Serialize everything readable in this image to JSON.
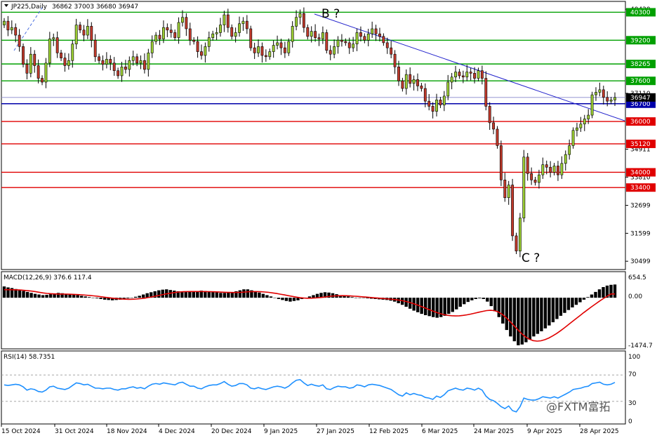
{
  "header": {
    "symbol": "JP225,Daily",
    "ohlc": "36862 37003 36680 36947"
  },
  "chart_data": [
    {
      "type": "candlestick",
      "title": "JP225,Daily",
      "ylim": [
        30200,
        40700
      ],
      "yticks": [
        40420,
        40300,
        39200,
        38265,
        37600,
        37110,
        36947,
        36700,
        36000,
        35120,
        34911,
        34000,
        33810,
        33400,
        32699,
        31599,
        30499
      ],
      "xlabels": [
        "15 Oct 2024",
        "31 Oct 2024",
        "18 Nov 2024",
        "4 Dec 2024",
        "20 Dec 2024",
        "9 Jan 2025",
        "27 Jan 2025",
        "12 Feb 2025",
        "6 Mar 2025",
        "24 Mar 2025",
        "9 Apr 2025",
        "28 Apr 2025"
      ],
      "levels": [
        {
          "value": 40300,
          "label": "40300",
          "color": "#00a000"
        },
        {
          "value": 39200,
          "label": "39200",
          "color": "#00a000"
        },
        {
          "value": 38265,
          "label": "38265",
          "color": "#00a000"
        },
        {
          "value": 37600,
          "label": "37600",
          "color": "#00a000"
        },
        {
          "value": 36700,
          "label": "36700",
          "color": "#0000aa"
        },
        {
          "value": 36000,
          "label": "36000",
          "color": "#e00000"
        },
        {
          "value": 35120,
          "label": "35120",
          "color": "#e00000"
        },
        {
          "value": 34000,
          "label": "34000",
          "color": "#e00000"
        },
        {
          "value": 33400,
          "label": "33400",
          "color": "#e00000"
        }
      ],
      "current_price": {
        "value": 36947,
        "label": "36947"
      },
      "annotations": [
        "B ?",
        "C ?"
      ],
      "bull_color": "#9acd32",
      "bear_color": "#c0392b",
      "closes": [
        39950,
        39600,
        39700,
        39400,
        38950,
        38250,
        37900,
        38650,
        38200,
        37700,
        37550,
        38300,
        39250,
        39300,
        38700,
        38500,
        38200,
        38400,
        39050,
        39800,
        39600,
        39400,
        39750,
        39200,
        38550,
        38400,
        38250,
        38450,
        38300,
        38000,
        37800,
        38150,
        38050,
        38400,
        38550,
        38300,
        38400,
        38050,
        38700,
        39150,
        39400,
        39250,
        39700,
        39600,
        39500,
        39300,
        39900,
        40100,
        39650,
        39200,
        39150,
        38750,
        38600,
        38950,
        39300,
        39450,
        39500,
        39800,
        40200,
        39700,
        39350,
        39500,
        39850,
        39950,
        39650,
        38900,
        38700,
        38950,
        38600,
        38550,
        38750,
        39000,
        39100,
        38900,
        38700,
        39150,
        39750,
        40100,
        40250,
        39700,
        39350,
        39550,
        39300,
        39250,
        39500,
        38800,
        38650,
        38950,
        39200,
        39150,
        39100,
        38900,
        39050,
        39500,
        39350,
        39200,
        39450,
        39650,
        39450,
        39350,
        39100,
        38900,
        38650,
        38150,
        37600,
        37300,
        37850,
        37500,
        37650,
        37400,
        37300,
        36800,
        36600,
        36400,
        36850,
        36650,
        37000,
        37550,
        37750,
        37950,
        37800,
        37750,
        37950,
        37900,
        37700,
        38000,
        37700,
        36600,
        35950,
        35700,
        35050,
        33700,
        33000,
        33500,
        31500,
        30900,
        32200,
        34600,
        33950,
        33700,
        33600,
        33900,
        34300,
        34200,
        34000,
        34250,
        33900,
        34350,
        34700,
        35050,
        35650,
        35750,
        35900,
        36100,
        36250,
        37050,
        37150,
        37250,
        36950,
        36800,
        36850,
        36947
      ],
      "macd": {
        "label": "MACD(12,26,9) 376.6 117.4",
        "yticks": [
          "654.5",
          "0.00",
          "-1474.7"
        ],
        "ylim": [
          -1520,
          700
        ],
        "histogram": [
          350,
          320,
          300,
          270,
          240,
          210,
          180,
          150,
          120,
          100,
          80,
          90,
          110,
          130,
          150,
          140,
          120,
          100,
          90,
          80,
          60,
          40,
          20,
          0,
          -20,
          -40,
          -60,
          -70,
          -80,
          -70,
          -60,
          -40,
          -20,
          0,
          30,
          60,
          100,
          140,
          170,
          200,
          230,
          250,
          260,
          240,
          220,
          200,
          190,
          180,
          190,
          200,
          210,
          220,
          210,
          200,
          190,
          170,
          150,
          150,
          160,
          170,
          200,
          230,
          260,
          260,
          230,
          200,
          160,
          120,
          80,
          40,
          0,
          -40,
          -70,
          -100,
          -120,
          -100,
          -80,
          -40,
          0,
          40,
          80,
          120,
          150,
          170,
          160,
          140,
          110,
          80,
          60,
          40,
          20,
          0,
          -10,
          -10,
          -20,
          -30,
          -40,
          -50,
          -60,
          -70,
          -90,
          -120,
          -170,
          -220,
          -280,
          -340,
          -400,
          -450,
          -500,
          -540,
          -570,
          -600,
          -620,
          -600,
          -560,
          -500,
          -440,
          -360,
          -280,
          -200,
          -130,
          -80,
          -40,
          -20,
          -40,
          -120,
          -260,
          -420,
          -600,
          -800,
          -1000,
          -1200,
          -1350,
          -1474,
          -1450,
          -1380,
          -1300,
          -1200,
          -1120,
          -1040,
          -950,
          -860,
          -760,
          -660,
          -560,
          -470,
          -380,
          -300,
          -220,
          -140,
          -60,
          20,
          100,
          180,
          260,
          330,
          376,
          400,
          410
        ],
        "signal": [
          250,
          250,
          248,
          245,
          240,
          230,
          220,
          205,
          190,
          170,
          150,
          135,
          125,
          118,
          115,
          115,
          112,
          108,
          104,
          98,
          90,
          80,
          70,
          58,
          45,
          30,
          15,
          0,
          -15,
          -28,
          -38,
          -45,
          -48,
          -46,
          -40,
          -30,
          -15,
          5,
          28,
          52,
          78,
          104,
          128,
          148,
          165,
          178,
          186,
          190,
          192,
          192,
          192,
          192,
          190,
          188,
          185,
          180,
          174,
          168,
          164,
          162,
          164,
          170,
          178,
          186,
          190,
          190,
          186,
          178,
          166,
          150,
          132,
          110,
          88,
          64,
          42,
          20,
          2,
          -10,
          -16,
          -14,
          -8,
          2,
          16,
          32,
          46,
          56,
          62,
          64,
          62,
          56,
          48,
          40,
          30,
          20,
          10,
          0,
          -10,
          -20,
          -30,
          -40,
          -52,
          -66,
          -84,
          -108,
          -138,
          -174,
          -214,
          -260,
          -308,
          -356,
          -404,
          -448,
          -488,
          -520,
          -544,
          -558,
          -564,
          -560,
          -548,
          -530,
          -506,
          -478,
          -450,
          -422,
          -400,
          -390,
          -400,
          -440,
          -510,
          -610,
          -730,
          -860,
          -990,
          -1110,
          -1210,
          -1285,
          -1330,
          -1345,
          -1335,
          -1300,
          -1250,
          -1185,
          -1110,
          -1025,
          -935,
          -840,
          -745,
          -650,
          -555,
          -460,
          -370,
          -280,
          -195,
          -110,
          -30,
          50,
          117,
          117
        ]
      },
      "rsi": {
        "label": "RSI(14) 58.7351",
        "yticks": [
          "100",
          "70",
          "30",
          "0"
        ],
        "ylim": [
          0,
          100
        ],
        "levels": [
          70,
          30
        ],
        "values": [
          55,
          54,
          55,
          56,
          55,
          52,
          47,
          49,
          48,
          45,
          44,
          47,
          52,
          53,
          50,
          49,
          48,
          50,
          54,
          58,
          57,
          55,
          56,
          53,
          50,
          50,
          49,
          50,
          50,
          48,
          47,
          49,
          49,
          51,
          52,
          50,
          51,
          49,
          53,
          56,
          57,
          56,
          58,
          57,
          56,
          55,
          58,
          59,
          56,
          53,
          53,
          50,
          49,
          52,
          54,
          55,
          55,
          57,
          60,
          56,
          53,
          54,
          57,
          57,
          55,
          50,
          49,
          51,
          49,
          48,
          50,
          52,
          53,
          52,
          50,
          53,
          58,
          62,
          63,
          58,
          54,
          56,
          54,
          53,
          55,
          49,
          48,
          51,
          53,
          52,
          52,
          50,
          51,
          55,
          54,
          52,
          55,
          56,
          55,
          54,
          52,
          50,
          48,
          44,
          40,
          38,
          43,
          40,
          42,
          40,
          39,
          36,
          35,
          33,
          38,
          36,
          40,
          46,
          48,
          50,
          48,
          47,
          50,
          49,
          47,
          50,
          47,
          38,
          33,
          31,
          27,
          22,
          19,
          23,
          16,
          14,
          22,
          35,
          33,
          32,
          32,
          34,
          37,
          36,
          35,
          37,
          35,
          38,
          41,
          44,
          48,
          49,
          50,
          52,
          53,
          57,
          58,
          59,
          56,
          55,
          56,
          58.7
        ]
      }
    }
  ],
  "watermark": {
    "text": "@FXTM富拓"
  }
}
